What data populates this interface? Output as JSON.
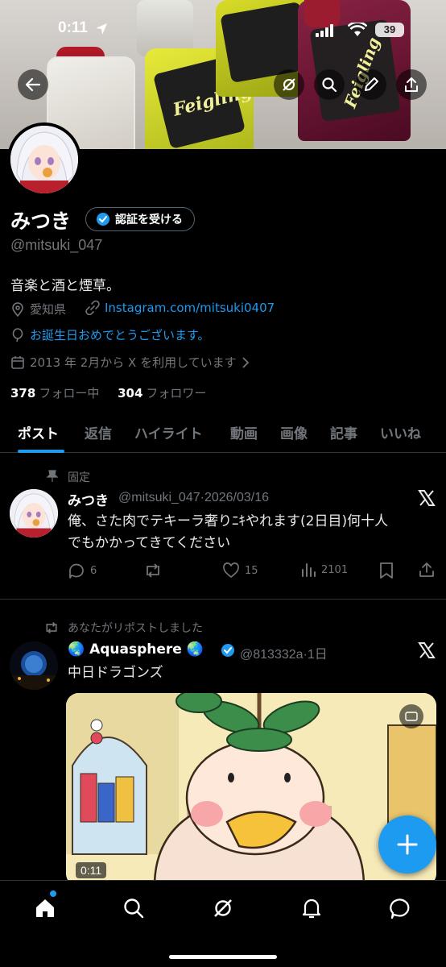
{
  "status_bar": {
    "time": "0:11",
    "battery": "39"
  },
  "banner": {
    "label_a": "Feigling",
    "label_b": "Feigling"
  },
  "profile": {
    "name": "みつき",
    "verify_label": "認証を受ける",
    "handle": "@mitsuki_047",
    "bio": "音楽と酒と煙草。",
    "location": "愛知県",
    "website": "Instagram.com/mitsuki0407",
    "birthday": "お誕生日おめでとうございます。",
    "joined": "2013 年 2月から X を利用しています",
    "following_count": "378",
    "following_label": "フォロー中",
    "followers_count": "304",
    "followers_label": "フォロワー"
  },
  "tabs": [
    "ポスト",
    "返信",
    "ハイライト",
    "動画",
    "画像",
    "記事",
    "いいね"
  ],
  "pinned_post": {
    "pinned_label": "固定",
    "name": "みつき",
    "handle_date": "@mitsuki_047·2026/03/16",
    "text_line1": "俺、さた肉でテキーラ奢りﾆｷやれます(2日目)何十人",
    "text_line2": "でもかかってきてください",
    "replies": "6",
    "likes": "15",
    "views": "2101"
  },
  "repost": {
    "repost_label": "あなたがリポストしました",
    "name": "🌏 Aquasphere 🌏",
    "handle_date": "@813332a·1日",
    "text": "中日ドラゴンズ",
    "video_time": "0:11"
  },
  "colors": {
    "accent": "#1d9bf0",
    "muted": "#71767b",
    "border": "#2f3336"
  }
}
